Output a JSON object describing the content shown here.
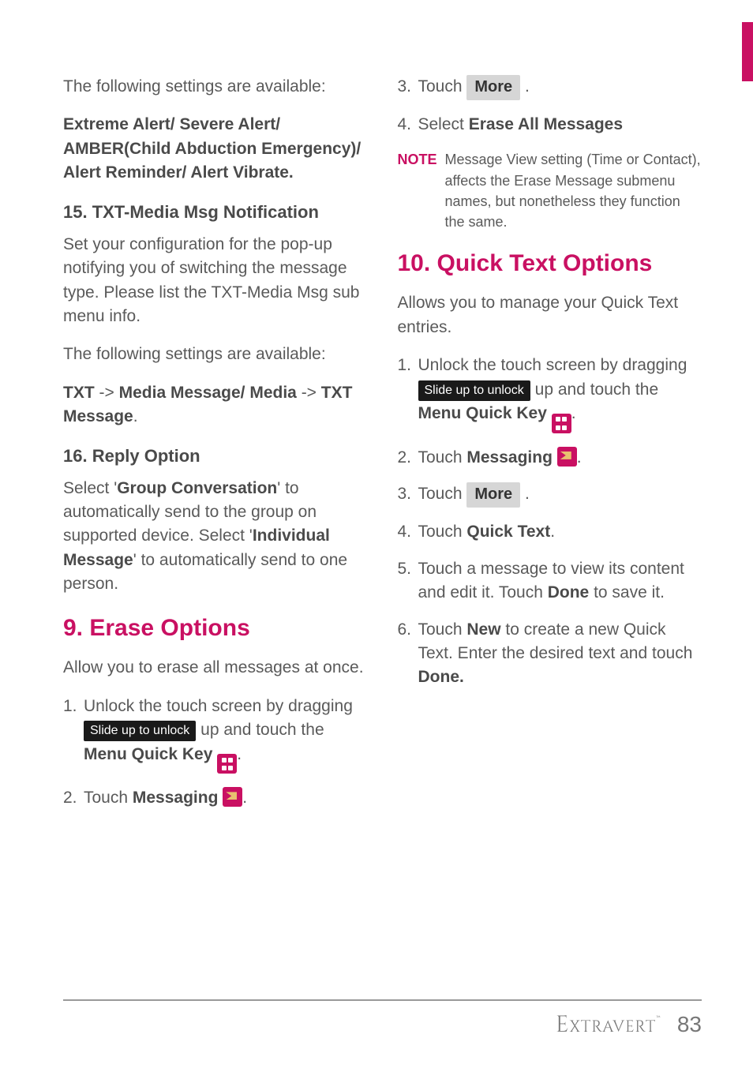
{
  "left": {
    "intro": "The following settings are available:",
    "alert_list": "Extreme Alert/ Severe Alert/ AMBER(Child Abduction Emergency)/ Alert Reminder/ Alert Vibrate.",
    "sec15_title": "15. TXT-Media Msg Notification",
    "sec15_body": "Set your configuration for the pop-up notifying you of switching the message type. Please list the TXT-Media Msg sub menu info.",
    "settings_avail": "The following settings are available:",
    "txt_media_1a": "TXT",
    "txt_media_1b": " -> ",
    "txt_media_1c": "Media Message/ Media",
    "txt_media_1d": " -> ",
    "txt_media_1e": "TXT Message",
    "sec16_title": "16. Reply Option",
    "sec16_a": "Select '",
    "sec16_b": "Group Conversation",
    "sec16_c": "' to automatically send to the group on supported device. Select '",
    "sec16_d": "Individual Message",
    "sec16_e": "' to automatically send to one person.",
    "h2_erase": "9. Erase Options",
    "erase_intro": "Allow you to erase all messages at once.",
    "step1_a": "Unlock the touch screen by dragging ",
    "step1_slide": "Slide up to unlock",
    "step1_b": " up and touch the ",
    "step1_c": "Menu Quick Key",
    "step2_a": "Touch ",
    "step2_b": "Messaging"
  },
  "right": {
    "step3_a": "Touch ",
    "more_btn": "More",
    "step4_a": "Select ",
    "step4_b": "Erase All Messages",
    "note_label": "NOTE",
    "note_body": "Message View setting (Time or Contact), affects the Erase Message submenu names, but nonetheless they function the same.",
    "h2_quick": "10. Quick Text Options",
    "quick_intro": "Allows you to manage your Quick Text entries.",
    "q_step1_a": "Unlock the touch screen by dragging ",
    "q_step1_slide": "Slide up to unlock",
    "q_step1_b": " up and touch the ",
    "q_step1_c": "Menu Quick Key",
    "q_step2_a": "Touch ",
    "q_step2_b": "Messaging",
    "q_step3_a": "Touch ",
    "q_more_btn": "More",
    "q_step4_a": "Touch ",
    "q_step4_b": "Quick Text",
    "q_step5_a": "Touch a message to view its content and edit it. Touch ",
    "q_step5_b": "Done",
    "q_step5_c": " to save it.",
    "q_step6_a": "Touch ",
    "q_step6_b": "New",
    "q_step6_c": " to create a new Quick Text. Enter the desired text and touch ",
    "q_step6_d": "Done."
  },
  "footer": {
    "brand": "Extravert",
    "page": "83"
  }
}
